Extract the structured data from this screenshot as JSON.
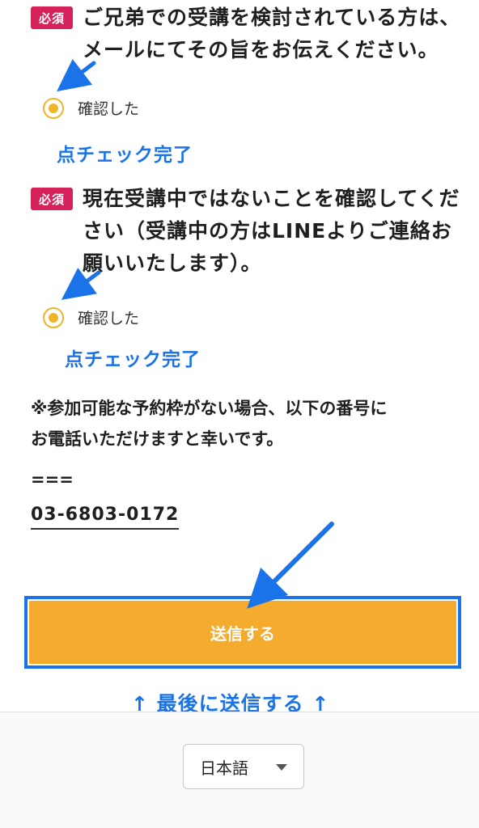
{
  "question1": {
    "badge": "必須",
    "line1": "ご兄弟での受講を検討されている方は、",
    "line2": "メールにてその旨をお伝えください。",
    "radio_label": "確認した",
    "annotation": "点チェック完了"
  },
  "question2": {
    "badge": "必須",
    "line1": "現在受講中ではないことを確認してくだ",
    "line2": "さい（受講中の方はLINEよりご連絡お",
    "line3": "願いいたします）。",
    "radio_label": "確認した",
    "annotation": "点チェック完了"
  },
  "note": {
    "line1": "※参加可能な予約枠がない場合、以下の番号に",
    "line2": "お電話いただけますと幸いです。",
    "separator": "===",
    "phone": "03-6803-0172"
  },
  "submit": {
    "label": "送信する",
    "annotation": "↑ 最後に送信する ↑"
  },
  "footer": {
    "language": "日本語"
  },
  "colors": {
    "badge": "#d6215a",
    "radio": "#f0b429",
    "submit": "#f5ab2e",
    "annotation": "#1a73e8"
  }
}
